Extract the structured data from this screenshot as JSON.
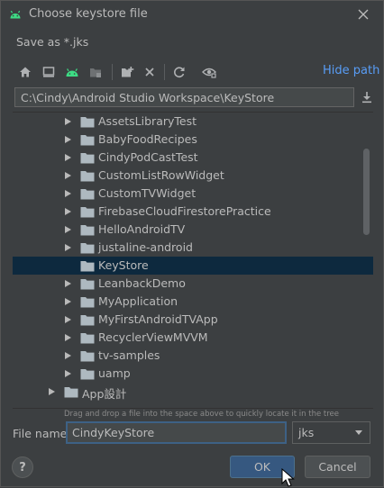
{
  "dialog": {
    "title": "Choose keystore file",
    "subtitle": "Save as *.jks",
    "icon": "android-icon"
  },
  "toolbar": {
    "buttons": [
      "home-icon",
      "desktop-icon",
      "android-project-icon",
      "module-icon",
      "new-folder-icon",
      "delete-icon",
      "refresh-icon",
      "show-hidden-icon"
    ],
    "hide_path_label": "Hide path"
  },
  "path": {
    "value": "C:\\Cindy\\Android Studio Workspace\\KeyStore"
  },
  "tree": {
    "items": [
      {
        "label": "AssetsLibraryTest",
        "expandable": true,
        "level": 1
      },
      {
        "label": "BabyFoodRecipes",
        "expandable": true,
        "level": 1
      },
      {
        "label": "CindyPodCastTest",
        "expandable": true,
        "level": 1
      },
      {
        "label": "CustomListRowWidget",
        "expandable": true,
        "level": 1
      },
      {
        "label": "CustomTVWidget",
        "expandable": true,
        "level": 1
      },
      {
        "label": "FirebaseCloudFirestorePractice",
        "expandable": true,
        "level": 1
      },
      {
        "label": "HelloAndroidTV",
        "expandable": true,
        "level": 1
      },
      {
        "label": "justaline-android",
        "expandable": true,
        "level": 1
      },
      {
        "label": "KeyStore",
        "expandable": false,
        "level": 1,
        "selected": true
      },
      {
        "label": "LeanbackDemo",
        "expandable": true,
        "level": 1
      },
      {
        "label": "MyApplication",
        "expandable": true,
        "level": 1
      },
      {
        "label": "MyFirstAndroidTVApp",
        "expandable": true,
        "level": 1
      },
      {
        "label": "RecyclerViewMVVM",
        "expandable": true,
        "level": 1
      },
      {
        "label": "tv-samples",
        "expandable": true,
        "level": 1
      },
      {
        "label": "uamp",
        "expandable": true,
        "level": 1
      },
      {
        "label": "App設計",
        "expandable": true,
        "level": 0
      }
    ],
    "hint": "Drag and drop a file into the space above to quickly locate it in the tree"
  },
  "file_name": {
    "label": "File name:",
    "value": "CindyKeyStore"
  },
  "extension": {
    "selected": "jks"
  },
  "buttons": {
    "help": "?",
    "ok": "OK",
    "cancel": "Cancel"
  },
  "colors": {
    "background": "#3c3f41",
    "link": "#589df6",
    "selection": "#0d293e",
    "folder": "#aeb9c0",
    "android": "#3ddc84",
    "ok_button": "#365880"
  }
}
